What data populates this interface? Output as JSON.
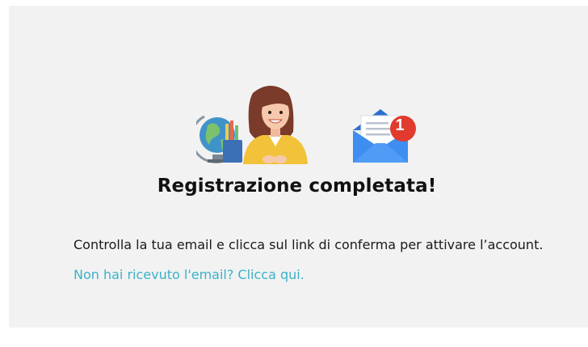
{
  "page": {
    "title": "Registrazione completata!",
    "message": "Controlla la tua email e clicca sul link di conferma per attivare l’account.",
    "resend_link": "Non hai ricevuto l'email? Clicca qui."
  },
  "notification": {
    "count": "1"
  },
  "icons": {
    "illustration": "teacher-with-globe-illustration",
    "mail": "open-envelope-with-notification-icon"
  },
  "colors": {
    "background": "#f2f2f2",
    "link": "#3ab2c8",
    "badge": "#e03b2e",
    "envelope": "#2f7fe0"
  }
}
